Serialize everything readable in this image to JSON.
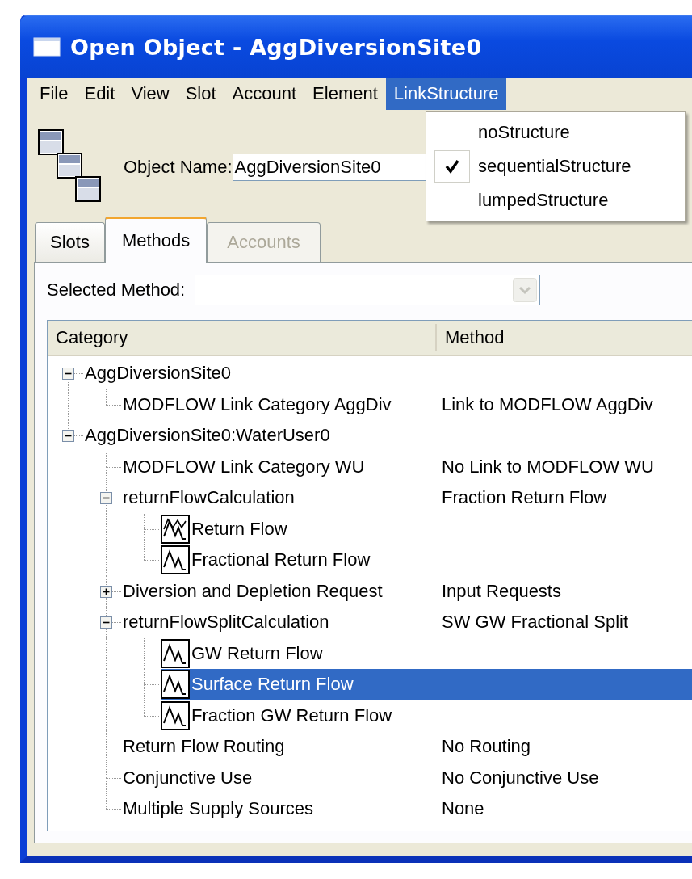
{
  "window": {
    "title": "Open Object - AggDiversionSite0"
  },
  "menu": [
    {
      "label": "File",
      "selected": false
    },
    {
      "label": "Edit",
      "selected": false
    },
    {
      "label": "View",
      "selected": false
    },
    {
      "label": "Slot",
      "selected": false
    },
    {
      "label": "Account",
      "selected": false
    },
    {
      "label": "Element",
      "selected": false
    },
    {
      "label": "LinkStructure",
      "selected": true
    }
  ],
  "dropdown": [
    {
      "label": "noStructure",
      "checked": false
    },
    {
      "label": "sequentialStructure",
      "checked": true
    },
    {
      "label": "lumpedStructure",
      "checked": false
    }
  ],
  "object_name": {
    "label": "Object Name:",
    "value": "AggDiversionSite0"
  },
  "tabs": [
    {
      "label": "Slots",
      "selected": false,
      "disabled": false
    },
    {
      "label": "Methods",
      "selected": true,
      "disabled": false
    },
    {
      "label": "Accounts",
      "selected": false,
      "disabled": true
    }
  ],
  "selected_method": {
    "label": "Selected Method:"
  },
  "tree": {
    "columns": [
      "Category",
      "Method"
    ],
    "rows": [
      {
        "kind": "category",
        "label": "AggDiversionSite0",
        "selected": false,
        "expanded": true,
        "children": [
          {
            "kind": "category",
            "label": "MODFLOW Link Category AggDiv",
            "method": "Link to MODFLOW AggDiv",
            "selected": false
          }
        ]
      },
      {
        "kind": "category",
        "label": "AggDiversionSite0:WaterUser0",
        "selected": false,
        "expanded": true,
        "children": [
          {
            "kind": "category",
            "label": "MODFLOW Link Category WU",
            "method": "No Link to MODFLOW WU",
            "selected": false
          },
          {
            "kind": "category",
            "label": "returnFlowCalculation",
            "method": "Fraction Return Flow",
            "selected": false,
            "expanded": true,
            "children": [
              {
                "kind": "multi-slot",
                "label": "Return Flow",
                "selected": false
              },
              {
                "kind": "slot",
                "label": "Fractional Return Flow",
                "selected": false
              }
            ]
          },
          {
            "kind": "category",
            "label": "Diversion and Depletion Request",
            "method": "Input Requests",
            "selected": false,
            "expanded": false
          },
          {
            "kind": "category",
            "label": "returnFlowSplitCalculation",
            "method": "SW GW Fractional Split",
            "selected": false,
            "expanded": true,
            "children": [
              {
                "kind": "slot",
                "label": "GW Return Flow",
                "selected": false
              },
              {
                "kind": "slot",
                "label": "Surface Return Flow",
                "selected": true
              },
              {
                "kind": "slot",
                "label": "Fraction GW Return Flow",
                "selected": false
              }
            ]
          },
          {
            "kind": "category",
            "label": "Return Flow Routing",
            "method": "No Routing",
            "selected": false
          },
          {
            "kind": "category",
            "label": "Conjunctive Use",
            "method": "No Conjunctive Use",
            "selected": false
          },
          {
            "kind": "category",
            "label": "Multiple Supply Sources",
            "method": "None",
            "selected": false
          }
        ]
      }
    ]
  }
}
